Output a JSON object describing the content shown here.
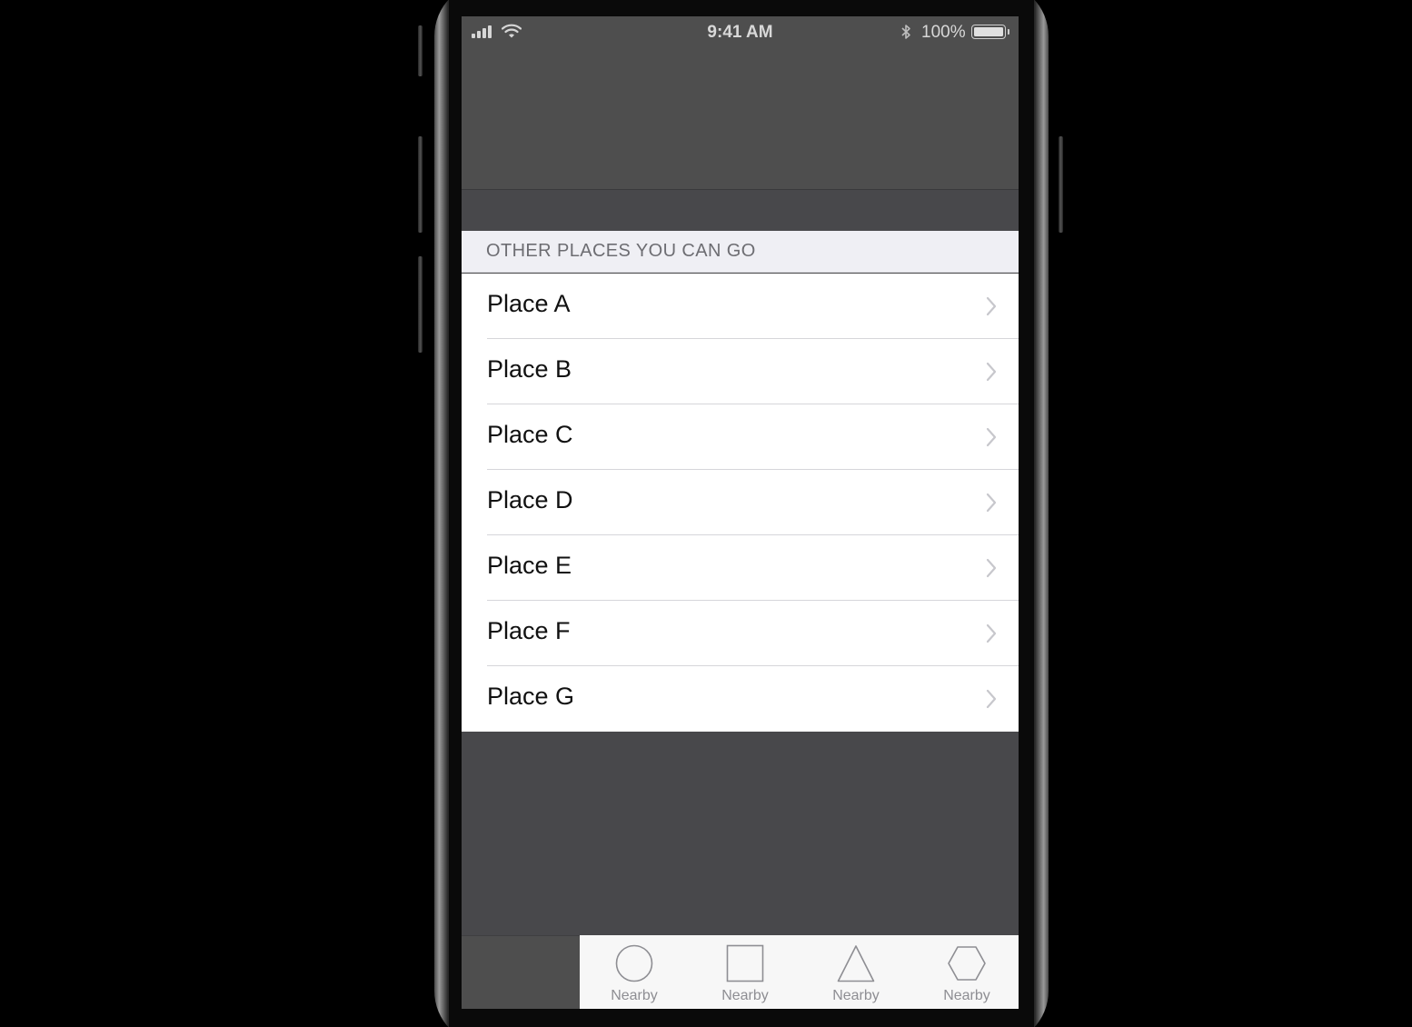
{
  "status_bar": {
    "time": "9:41 AM",
    "battery_percent": "100%",
    "battery_level": 1.0,
    "signal_bars": 4,
    "icons": [
      "signal-icon",
      "wifi-icon",
      "bluetooth-icon",
      "battery-icon"
    ]
  },
  "section": {
    "header": "OTHER PLACES YOU CAN GO"
  },
  "places": [
    {
      "label": "Place A"
    },
    {
      "label": "Place B"
    },
    {
      "label": "Place C"
    },
    {
      "label": "Place D"
    },
    {
      "label": "Place E"
    },
    {
      "label": "Place F"
    },
    {
      "label": "Place G"
    }
  ],
  "tab_bar": {
    "tabs": [
      {
        "label": "Nearby",
        "icon": "circle-icon"
      },
      {
        "label": "Nearby",
        "icon": "square-icon"
      },
      {
        "label": "Nearby",
        "icon": "triangle-icon"
      },
      {
        "label": "Nearby",
        "icon": "hexagon-icon"
      }
    ]
  },
  "colors": {
    "dimmed_background": "#48484b",
    "top_area": "#4e4e4e",
    "section_header_bg": "#efeff4",
    "section_header_text": "#6d6d72",
    "row_bg": "#ffffff",
    "row_text": "#111111",
    "chevron": "#c7c7cc",
    "tabbar_bg": "#f7f7f7",
    "tab_inactive": "#8e8e93"
  }
}
